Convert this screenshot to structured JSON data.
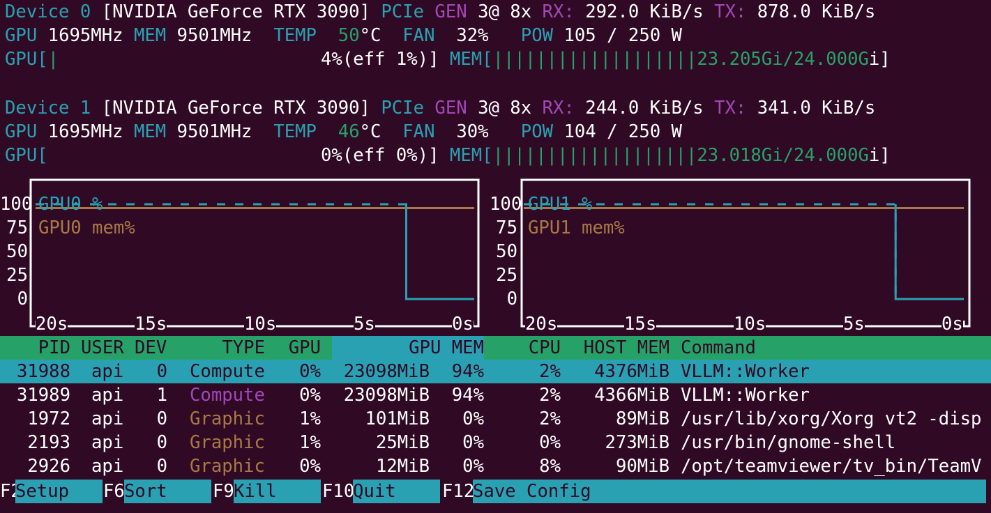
{
  "devices": [
    {
      "header_prefix": "Device 0",
      "name": "[NVIDIA GeForce RTX 3090]",
      "pcie_label": "PCIe",
      "gen_label": "GEN",
      "gen_value": "3@ 8x",
      "rx_label": "RX:",
      "rx_value": "292.0 KiB/s",
      "tx_label": "TX:",
      "tx_value": "878.0 KiB/s",
      "gpu_clock_label": "GPU",
      "gpu_clock": "1695MHz",
      "mem_clock_label": "MEM",
      "mem_clock": "9501MHz",
      "temp_label": "TEMP",
      "temp_value": "50",
      "temp_unit": "°C",
      "fan_label": "FAN",
      "fan_value": "32%",
      "pow_label": "POW",
      "pow_value": "105 / 250 W",
      "util_label": "GPU[",
      "util_bar": "|",
      "util_text": "4%(eff 1%)]",
      "mem_label": "MEM[",
      "mem_bar": "|||||||||||||||||||",
      "mem_text": "23.205Gi/24.000G",
      "mem_close": "i]"
    },
    {
      "header_prefix": "Device 1",
      "name": "[NVIDIA GeForce RTX 3090]",
      "pcie_label": "PCIe",
      "gen_label": "GEN",
      "gen_value": "3@ 8x",
      "rx_label": "RX:",
      "rx_value": "244.0 KiB/s",
      "tx_label": "TX:",
      "tx_value": "341.0 KiB/s",
      "gpu_clock_label": "GPU",
      "gpu_clock": "1695MHz",
      "mem_clock_label": "MEM",
      "mem_clock": "9501MHz",
      "temp_label": "TEMP",
      "temp_value": "46",
      "temp_unit": "°C",
      "fan_label": "FAN",
      "fan_value": "30%",
      "pow_label": "POW",
      "pow_value": "104 / 250 W",
      "util_label": "GPU[",
      "util_bar": "",
      "util_text": "0%(eff 0%)]",
      "mem_label": "MEM[",
      "mem_bar": "|||||||||||||||||||",
      "mem_text": "23.018Gi/24.000G",
      "mem_close": "i]"
    }
  ],
  "chart_data": [
    {
      "type": "line",
      "title": "",
      "y_ticks": [
        "100",
        "75",
        "50",
        "25",
        "0"
      ],
      "x_ticks": [
        "20s",
        "15s",
        "10s",
        "5s",
        "0s"
      ],
      "ylim": [
        0,
        100
      ],
      "series": [
        {
          "name": "GPU0 %",
          "color": "#2aa1b3",
          "x": [
            -20,
            -3.1,
            -3.1,
            0
          ],
          "values": [
            100,
            100,
            0,
            0
          ]
        },
        {
          "name": "GPU0 mem%",
          "color": "#a87946",
          "x": [
            -20,
            0
          ],
          "values": [
            96,
            96
          ]
        }
      ]
    },
    {
      "type": "line",
      "title": "",
      "y_ticks": [
        "100",
        "75",
        "50",
        "25",
        "0"
      ],
      "x_ticks": [
        "20s",
        "15s",
        "10s",
        "5s",
        "0s"
      ],
      "ylim": [
        0,
        100
      ],
      "series": [
        {
          "name": "GPU1 %",
          "color": "#2aa1b3",
          "x": [
            -20,
            -3.1,
            -3.1,
            0
          ],
          "values": [
            100,
            100,
            0,
            0
          ]
        },
        {
          "name": "GPU1 mem%",
          "color": "#a87946",
          "x": [
            -20,
            0
          ],
          "values": [
            96,
            96
          ]
        }
      ]
    }
  ],
  "process_table": {
    "headers": {
      "pid": "PID",
      "user": "USER",
      "dev": "DEV",
      "type": "TYPE",
      "gpu": "GPU",
      "gpu_mem": "GPU MEM",
      "cpu": "CPU",
      "host_mem": "HOST MEM",
      "command": "Command"
    },
    "rows": [
      {
        "pid": "31988",
        "user": "api",
        "dev": "0",
        "type": "Compute",
        "gpu": "0%",
        "gpu_mem": "23098MiB",
        "gpu_mem_pct": "94%",
        "cpu": "2%",
        "host_mem": "4376MiB",
        "command": "VLLM::Worker",
        "selected": true
      },
      {
        "pid": "31989",
        "user": "api",
        "dev": "1",
        "type": "Compute",
        "gpu": "0%",
        "gpu_mem": "23098MiB",
        "gpu_mem_pct": "94%",
        "cpu": "2%",
        "host_mem": "4366MiB",
        "command": "VLLM::Worker"
      },
      {
        "pid": "1972",
        "user": "api",
        "dev": "0",
        "type": "Graphic",
        "gpu": "1%",
        "gpu_mem": "101MiB",
        "gpu_mem_pct": "0%",
        "cpu": "2%",
        "host_mem": "89MiB",
        "command": "/usr/lib/xorg/Xorg vt2 -disp"
      },
      {
        "pid": "2193",
        "user": "api",
        "dev": "0",
        "type": "Graphic",
        "gpu": "1%",
        "gpu_mem": "25MiB",
        "gpu_mem_pct": "0%",
        "cpu": "0%",
        "host_mem": "273MiB",
        "command": "/usr/bin/gnome-shell"
      },
      {
        "pid": "2926",
        "user": "api",
        "dev": "0",
        "type": "Graphic",
        "gpu": "0%",
        "gpu_mem": "12MiB",
        "gpu_mem_pct": "0%",
        "cpu": "8%",
        "host_mem": "90MiB",
        "command": "/opt/teamviewer/tv_bin/TeamV"
      }
    ]
  },
  "footer": {
    "items": [
      {
        "key": "F2",
        "label": "Setup"
      },
      {
        "key": "F6",
        "label": "Sort"
      },
      {
        "key": "F9",
        "label": "Kill"
      },
      {
        "key": "F10",
        "label": "Quit"
      },
      {
        "key": "F12",
        "label": "Save Config"
      }
    ]
  },
  "colors": {
    "background": "#300a24",
    "cyan": "#2aa1b3",
    "purple": "#a347ba",
    "green": "#26a269",
    "brown": "#a87946"
  }
}
